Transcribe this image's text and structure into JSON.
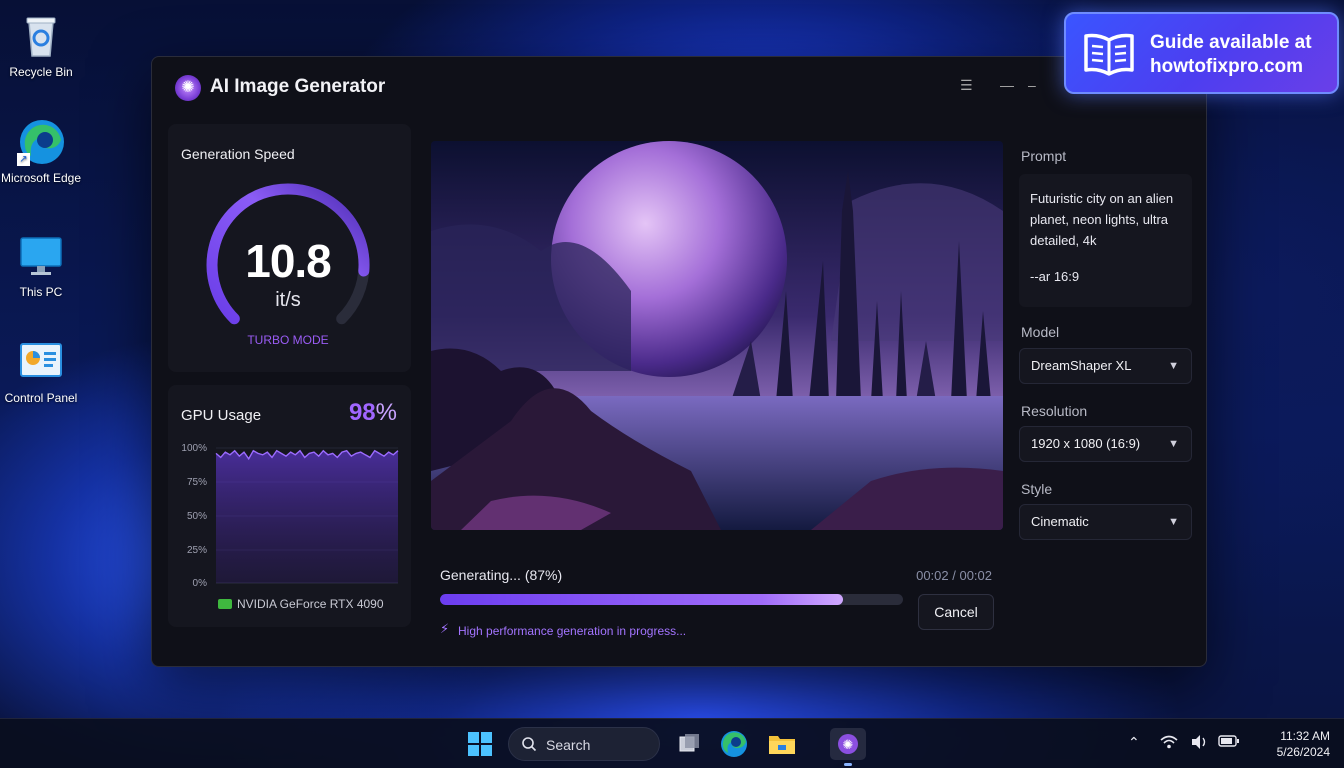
{
  "desktop": {
    "icons": [
      {
        "label": "Recycle Bin"
      },
      {
        "label": "Microsoft Edge"
      },
      {
        "label": "This PC"
      },
      {
        "label": "Control Panel"
      }
    ]
  },
  "app": {
    "title": "AI Image Generator",
    "speed": {
      "title": "Generation Speed",
      "value": "10.8",
      "unit": "it/s",
      "mode": "TURBO MODE",
      "gauge_fraction": 0.85
    },
    "gpu": {
      "title": "GPU Usage",
      "percent_value": "98",
      "percent_sign": "%",
      "y_ticks": [
        "100%",
        "75%",
        "50%",
        "25%",
        "0%"
      ],
      "name": "NVIDIA GeForce RTX 4090",
      "usage_series": [
        96,
        93,
        97,
        95,
        98,
        94,
        97,
        92,
        98,
        96,
        95,
        97,
        93,
        98,
        96,
        94,
        97,
        95,
        98,
        93,
        96,
        97,
        94,
        98,
        95,
        96,
        93,
        97,
        98,
        94,
        96,
        97,
        95,
        93,
        98,
        96,
        94,
        97,
        95,
        98
      ]
    },
    "generation": {
      "status": "Generating... (87%)",
      "progress": 0.87,
      "time": "00:02 / 00:02",
      "cancel_label": "Cancel",
      "note": "High performance generation in progress..."
    },
    "prompt": {
      "label": "Prompt",
      "text": "Futuristic city on an alien planet, neon lights, ultra detailed, 4k",
      "args": "--ar 16:9"
    },
    "model": {
      "label": "Model",
      "value": "DreamShaper XL"
    },
    "resolution": {
      "label": "Resolution",
      "value": "1920 x 1080 (16:9)"
    },
    "style": {
      "label": "Style",
      "value": "Cinematic"
    }
  },
  "guide": {
    "line1": "Guide available at",
    "line2": "howtofixpro.com"
  },
  "taskbar": {
    "search_label": "Search",
    "time": "11:32 AM",
    "date": "5/26/2024"
  },
  "colors": {
    "accent": "#9a5cf5",
    "window_bg": "#0f1018",
    "card_bg": "#15161f"
  }
}
